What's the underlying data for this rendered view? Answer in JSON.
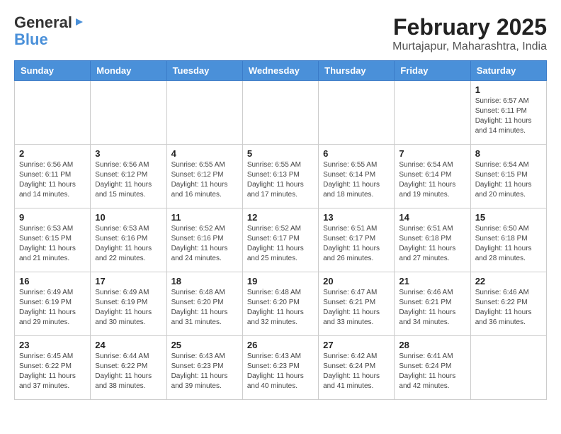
{
  "logo": {
    "general": "General",
    "blue": "Blue"
  },
  "title": "February 2025",
  "location": "Murtajapur, Maharashtra, India",
  "days_of_week": [
    "Sunday",
    "Monday",
    "Tuesday",
    "Wednesday",
    "Thursday",
    "Friday",
    "Saturday"
  ],
  "weeks": [
    [
      {
        "day": "",
        "info": ""
      },
      {
        "day": "",
        "info": ""
      },
      {
        "day": "",
        "info": ""
      },
      {
        "day": "",
        "info": ""
      },
      {
        "day": "",
        "info": ""
      },
      {
        "day": "",
        "info": ""
      },
      {
        "day": "1",
        "info": "Sunrise: 6:57 AM\nSunset: 6:11 PM\nDaylight: 11 hours\nand 14 minutes."
      }
    ],
    [
      {
        "day": "2",
        "info": "Sunrise: 6:56 AM\nSunset: 6:11 PM\nDaylight: 11 hours\nand 14 minutes."
      },
      {
        "day": "3",
        "info": "Sunrise: 6:56 AM\nSunset: 6:12 PM\nDaylight: 11 hours\nand 15 minutes."
      },
      {
        "day": "4",
        "info": "Sunrise: 6:55 AM\nSunset: 6:12 PM\nDaylight: 11 hours\nand 16 minutes."
      },
      {
        "day": "5",
        "info": "Sunrise: 6:55 AM\nSunset: 6:13 PM\nDaylight: 11 hours\nand 17 minutes."
      },
      {
        "day": "6",
        "info": "Sunrise: 6:55 AM\nSunset: 6:14 PM\nDaylight: 11 hours\nand 18 minutes."
      },
      {
        "day": "7",
        "info": "Sunrise: 6:54 AM\nSunset: 6:14 PM\nDaylight: 11 hours\nand 19 minutes."
      },
      {
        "day": "8",
        "info": "Sunrise: 6:54 AM\nSunset: 6:15 PM\nDaylight: 11 hours\nand 20 minutes."
      }
    ],
    [
      {
        "day": "9",
        "info": "Sunrise: 6:53 AM\nSunset: 6:15 PM\nDaylight: 11 hours\nand 21 minutes."
      },
      {
        "day": "10",
        "info": "Sunrise: 6:53 AM\nSunset: 6:16 PM\nDaylight: 11 hours\nand 22 minutes."
      },
      {
        "day": "11",
        "info": "Sunrise: 6:52 AM\nSunset: 6:16 PM\nDaylight: 11 hours\nand 24 minutes."
      },
      {
        "day": "12",
        "info": "Sunrise: 6:52 AM\nSunset: 6:17 PM\nDaylight: 11 hours\nand 25 minutes."
      },
      {
        "day": "13",
        "info": "Sunrise: 6:51 AM\nSunset: 6:17 PM\nDaylight: 11 hours\nand 26 minutes."
      },
      {
        "day": "14",
        "info": "Sunrise: 6:51 AM\nSunset: 6:18 PM\nDaylight: 11 hours\nand 27 minutes."
      },
      {
        "day": "15",
        "info": "Sunrise: 6:50 AM\nSunset: 6:18 PM\nDaylight: 11 hours\nand 28 minutes."
      }
    ],
    [
      {
        "day": "16",
        "info": "Sunrise: 6:49 AM\nSunset: 6:19 PM\nDaylight: 11 hours\nand 29 minutes."
      },
      {
        "day": "17",
        "info": "Sunrise: 6:49 AM\nSunset: 6:19 PM\nDaylight: 11 hours\nand 30 minutes."
      },
      {
        "day": "18",
        "info": "Sunrise: 6:48 AM\nSunset: 6:20 PM\nDaylight: 11 hours\nand 31 minutes."
      },
      {
        "day": "19",
        "info": "Sunrise: 6:48 AM\nSunset: 6:20 PM\nDaylight: 11 hours\nand 32 minutes."
      },
      {
        "day": "20",
        "info": "Sunrise: 6:47 AM\nSunset: 6:21 PM\nDaylight: 11 hours\nand 33 minutes."
      },
      {
        "day": "21",
        "info": "Sunrise: 6:46 AM\nSunset: 6:21 PM\nDaylight: 11 hours\nand 34 minutes."
      },
      {
        "day": "22",
        "info": "Sunrise: 6:46 AM\nSunset: 6:22 PM\nDaylight: 11 hours\nand 36 minutes."
      }
    ],
    [
      {
        "day": "23",
        "info": "Sunrise: 6:45 AM\nSunset: 6:22 PM\nDaylight: 11 hours\nand 37 minutes."
      },
      {
        "day": "24",
        "info": "Sunrise: 6:44 AM\nSunset: 6:22 PM\nDaylight: 11 hours\nand 38 minutes."
      },
      {
        "day": "25",
        "info": "Sunrise: 6:43 AM\nSunset: 6:23 PM\nDaylight: 11 hours\nand 39 minutes."
      },
      {
        "day": "26",
        "info": "Sunrise: 6:43 AM\nSunset: 6:23 PM\nDaylight: 11 hours\nand 40 minutes."
      },
      {
        "day": "27",
        "info": "Sunrise: 6:42 AM\nSunset: 6:24 PM\nDaylight: 11 hours\nand 41 minutes."
      },
      {
        "day": "28",
        "info": "Sunrise: 6:41 AM\nSunset: 6:24 PM\nDaylight: 11 hours\nand 42 minutes."
      },
      {
        "day": "",
        "info": ""
      }
    ]
  ]
}
